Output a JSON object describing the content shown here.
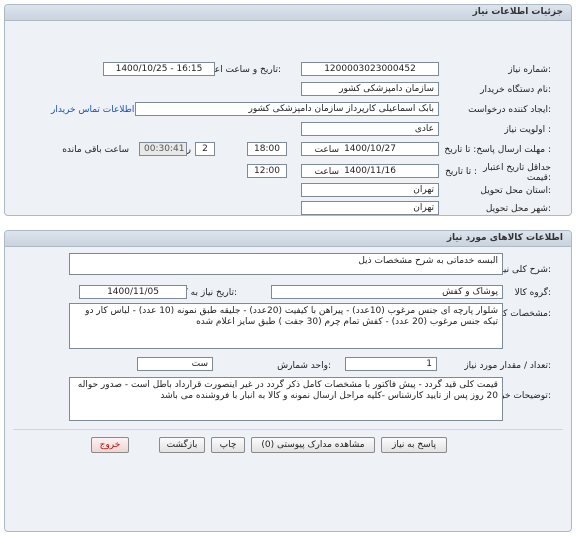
{
  "panel1": {
    "title": "جزئیات اطلاعات نیاز",
    "need_number_label": "شماره نیاز:",
    "need_number": "1200003023000452",
    "announce_label": "تاریخ و ساعت اعلان عمومی:",
    "announce_value": "1400/10/25 - 16:15",
    "buyer_label": "نام دستگاه خریدار:",
    "buyer_value": "سازمان دامپزشکی کشور",
    "creator_label": "ایجاد کننده درخواست:",
    "creator_value": "بابک اسماعیلی کارپرداز سازمان دامپزشکی کشور",
    "contact_link": "اطلاعات تماس خریدار",
    "priority_label": "اولویت نیاز :",
    "priority_value": "عادی",
    "deadline_label": "مهلت ارسال پاسخ: تا تاریخ :",
    "deadline_date": "1400/10/27",
    "time_label": "ساعت",
    "deadline_time": "18:00",
    "days_value": "2",
    "days_label": "روز و",
    "remaining_time": "00:30:41",
    "remaining_label": "ساعت باقی مانده",
    "validity_label": "حداقل تاریخ اعتبار قیمت:",
    "validity_to_label": "تا تاریخ :",
    "validity_date": "1400/11/16",
    "validity_time_label": "ساعت",
    "validity_time": "12:00",
    "province_label": "استان محل تحویل:",
    "province_value": "تهران",
    "city_label": "شهر محل تحویل:",
    "city_value": "تهران"
  },
  "panel2": {
    "title": "اطلاعات کالاهای مورد نیاز",
    "summary_label": "شرح کلی نیاز:",
    "summary_value": "البسه خدماتی به شرح مشخصات ذیل",
    "group_label": "گروه کالا:",
    "group_value": "پوشاک و کفش",
    "need_date_label": "تاریخ نیاز به کالا:",
    "need_date_value": "1400/11/05",
    "spec_label": "مشخصات کالای مورد نیاز:",
    "spec_value": "شلوار پارچه ای جنس مرغوب (10عدد) - پیراهن با کیفیت (20عدد) - جلیقه طبق نمونه (10 عدد) - لباس کار دو تیکه جنس مرغوب (20 عدد) - کفش تمام چرم (30 جفت ) طبق سایز اعلام شده",
    "qty_label": "تعداد / مقدار مورد نیاز:",
    "qty_value": "1",
    "unit_label": "واحد شمارش:",
    "unit_value": "ست",
    "notes_label": "توضیحات خریدار:",
    "notes_value": "قیمت کلی قید گردد - پیش فاکتور با مشخصات کامل ذکر گردد در غیر اینصورت قرارداد باطل است - صدور حواله 20 روز پس از تایید کارشناس -کلیه مراحل ارسال نمونه و کالا به انبار با فروشنده می باشد"
  },
  "buttons": {
    "reply": "پاسخ به نیاز",
    "attachments": "مشاهده مدارک پیوستی (0)",
    "print": "چاپ",
    "back": "بازگشت",
    "exit": "خروج"
  }
}
